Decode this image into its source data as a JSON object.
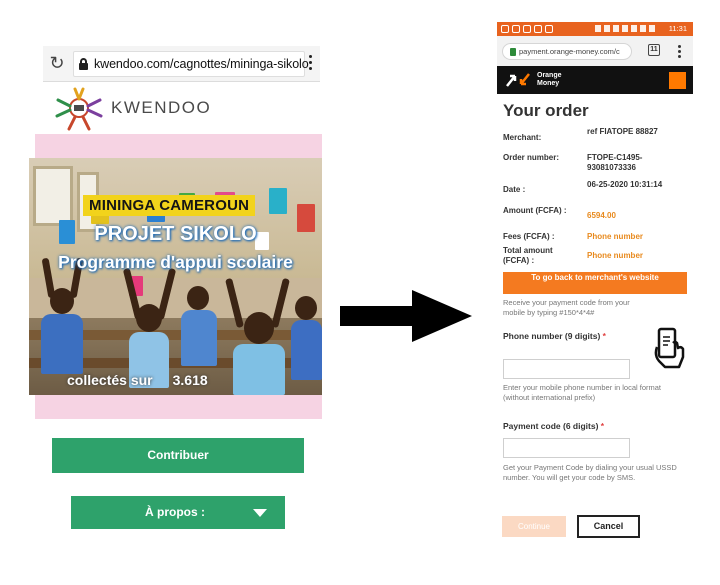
{
  "kwendoo": {
    "url": "kwendoo.com/cagnottes/mininga-sikolo",
    "logo_text": "KWENDOO",
    "hero": {
      "tag_title": "MININGA CAMEROUN",
      "project_title": "PROJET SIKOLO",
      "subtitle": "Programme d'appui scolaire",
      "collected_label": "collectés sur",
      "collected_value": "3.618"
    },
    "contribute_label": "Contribuer",
    "about_label": "À propos :"
  },
  "orange_money": {
    "status_time": "11:31",
    "url": "payment.orange-money.com/c",
    "tabs_count": "11",
    "brand_line1": "Orange",
    "brand_line2": "Money",
    "title": "Your order",
    "fields": [
      {
        "label": "Merchant:",
        "value": "ref FIATOPE 88827",
        "style": "dark"
      },
      {
        "label": "Order number:",
        "value": "FTOPE-C1495-93081073336",
        "style": "dark"
      },
      {
        "label": "Date :",
        "value": "06-25-2020 10:31:14",
        "style": "dark"
      },
      {
        "label": "Amount (FCFA) :",
        "value": "6594.00",
        "style": "orange"
      },
      {
        "label": "Fees (FCFA) :",
        "value": "Phone number",
        "style": "orange"
      },
      {
        "label": "Total amount (FCFA) :",
        "value": "Phone number",
        "style": "orange"
      }
    ],
    "back_button": "To go back to merchant's website",
    "ussd_help": "Receive your payment code from your mobile by typing #150*4*4#",
    "phone_label": "Phone number (9 digits)",
    "phone_help": "Enter your mobile phone number in local format (without international prefix)",
    "code_label": "Payment code (6 digits)",
    "code_help": "Get your Payment Code by dialing your usual USSD number. You will get your code by SMS.",
    "required_mark": "*",
    "continue_label": "Continue",
    "cancel_label": "Cancel",
    "colors": {
      "orange": "#ff7900",
      "header": "#111111",
      "status": "#e8631f"
    }
  },
  "icons": [
    "reload-icon",
    "lock-icon",
    "menu-icon",
    "caret-down-icon",
    "arrow-right-icon",
    "tabs-icon",
    "phone-hand-icon"
  ]
}
